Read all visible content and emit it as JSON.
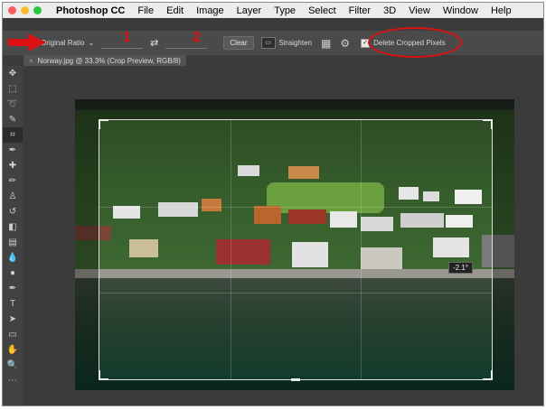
{
  "menubar": {
    "app_name": "Photoshop CC",
    "items": [
      "File",
      "Edit",
      "Image",
      "Layer",
      "Type",
      "Select",
      "Filter",
      "3D",
      "View",
      "Window",
      "Help"
    ]
  },
  "options_bar": {
    "ratio_label": "Original Ratio",
    "clear_label": "Clear",
    "straighten_label": "Straighten",
    "delete_cropped_label": "Delete Cropped Pixels",
    "delete_cropped_checked": true
  },
  "annotations": {
    "num1": "1",
    "num2": "2"
  },
  "document": {
    "tab_title": "Norway.jpg @ 33.3% (Crop Preview, RGB/8)",
    "angle_readout": "-2.1°"
  },
  "colors": {
    "annotation_red": "#d11111",
    "traffic_close": "#fc5f57",
    "traffic_min": "#fdbc2e",
    "traffic_max": "#28c840"
  }
}
